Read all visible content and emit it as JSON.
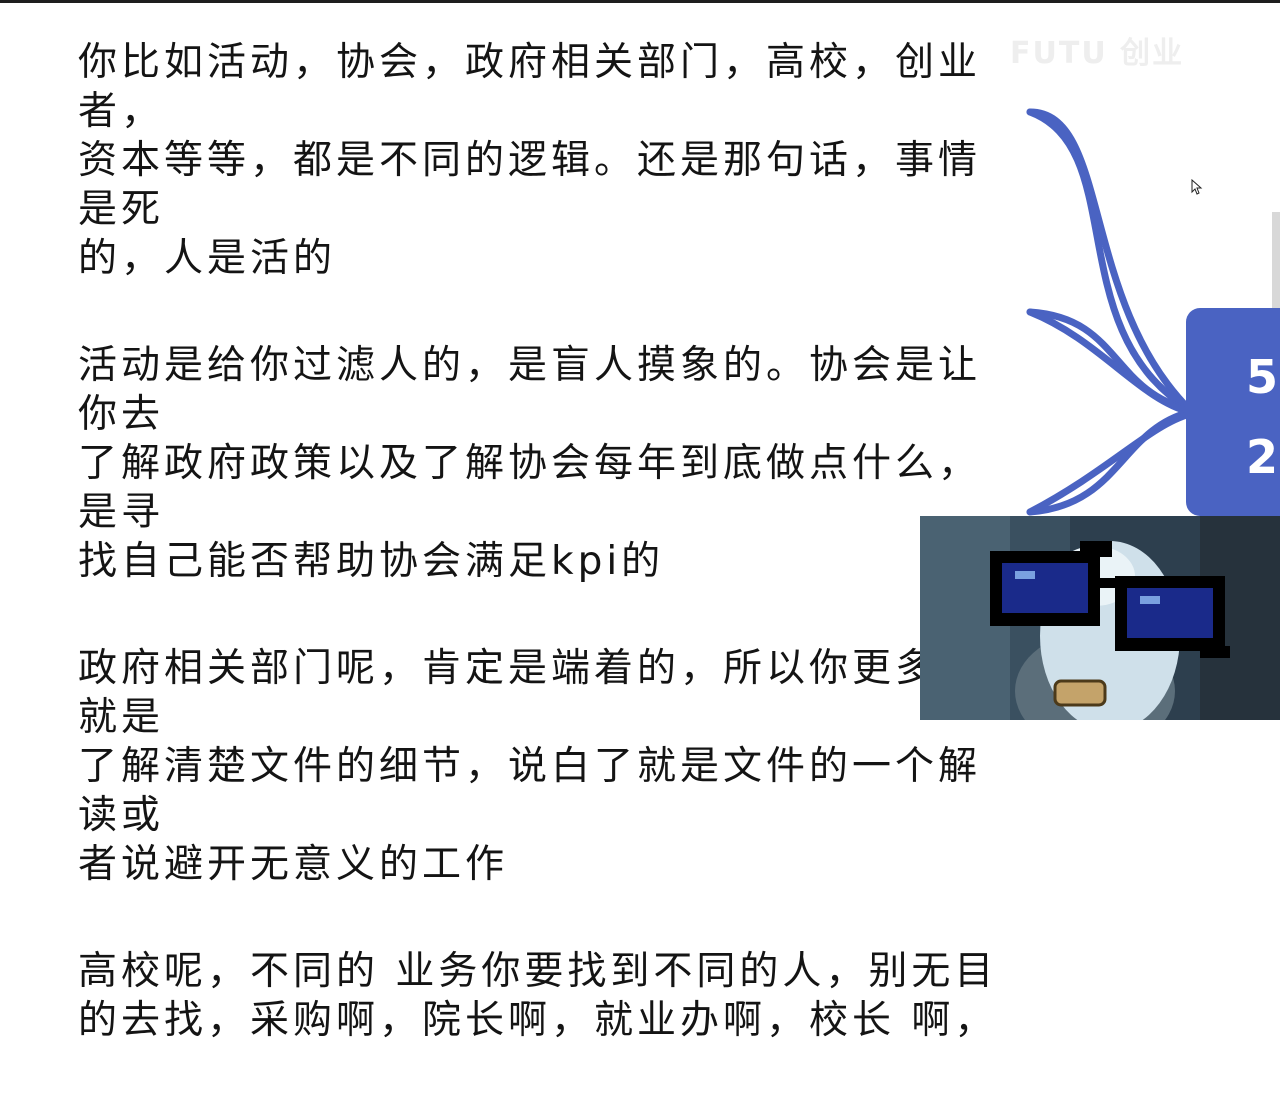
{
  "content": {
    "paragraphs": [
      {
        "lines": [
          "你比如活动，协会，政府相关部门，高校，创业者，",
          "资本等等，都是不同的逻辑。还是那句话，事情是死",
          "的，人是活的"
        ]
      },
      {
        "lines": [
          "活动是给你过滤人的，是盲人摸象的。协会是让你去",
          "了解政府政策以及了解协会每年到底做点什么，是寻",
          "找自己能否帮助协会满足kpi的"
        ]
      },
      {
        "lines": [
          "政府相关部门呢，肯定是端着的，所以你更多的就是",
          "了解清楚文件的细节，说白了就是文件的一个解读或",
          "者说避开无意义的工作"
        ]
      },
      {
        "lines": [
          "高校呢，不同的 业务你要找到不同的人，别无目",
          "的去找，采购啊，院长啊，就业办啊，校长 啊，"
        ]
      }
    ]
  },
  "overlay": {
    "watermark": "FUTU 创业",
    "panel_glyphs": [
      "5",
      "2"
    ]
  },
  "colors": {
    "text": "#141414",
    "accent_blue": "#4a63c2",
    "webcam_background": "#2d3f4e"
  },
  "icons": {
    "cursor": "mouse-pointer-icon",
    "webcam": "webcam-feed-icon"
  }
}
